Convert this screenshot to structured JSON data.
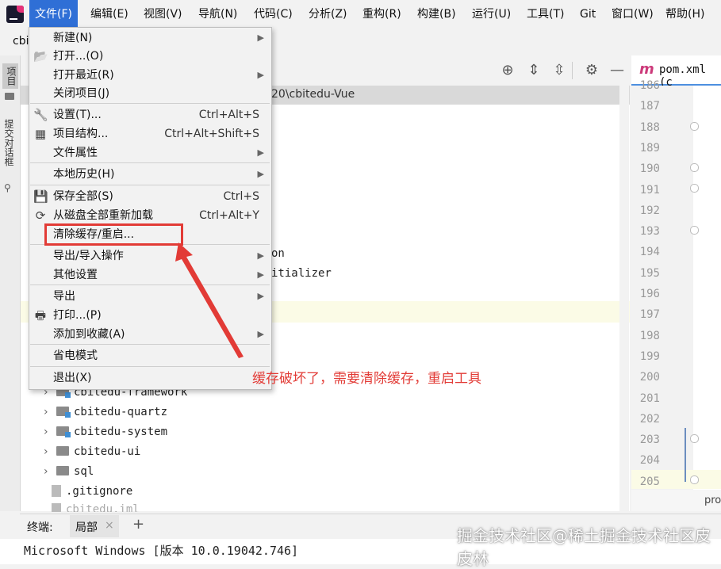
{
  "menubar": {
    "items": [
      "文件(F)",
      "编辑(E)",
      "视图(V)",
      "导航(N)",
      "代码(C)",
      "分析(Z)",
      "重构(R)",
      "构建(B)",
      "运行(U)",
      "工具(T)",
      "Git",
      "窗口(W)",
      "帮助(H)"
    ],
    "active_index": 0
  },
  "project_crumb": "cbi",
  "left_tabs": {
    "project": "项目",
    "commit": "提交对话框"
  },
  "tree": {
    "path_fragment": "20\\cbitedu-Vue",
    "partial_lines": [
      "on",
      "itializer"
    ],
    "rows": [
      {
        "label": "cbitedu-framework",
        "icon": "module-folder-icon"
      },
      {
        "label": "cbitedu-quartz",
        "icon": "module-folder-icon"
      },
      {
        "label": "cbitedu-system",
        "icon": "module-folder-icon"
      },
      {
        "label": "cbitedu-ui",
        "icon": "module-folder-icon"
      },
      {
        "label": "sql",
        "icon": "folder-icon"
      },
      {
        "label": ".gitignore",
        "icon": "file-icon"
      },
      {
        "label": "cbitedu.iml",
        "icon": "file-icon"
      }
    ]
  },
  "editor": {
    "tab_icon": "m",
    "tab_label": "pom.xml (c",
    "line_numbers": [
      "186",
      "187",
      "188",
      "189",
      "190",
      "191",
      "192",
      "193",
      "194",
      "195",
      "196",
      "197",
      "198",
      "199",
      "200",
      "201",
      "202",
      "203",
      "204",
      "205"
    ],
    "bottom_text": "pro"
  },
  "terminal": {
    "label": "终端:",
    "tab_label": "局部",
    "close": "×",
    "add": "+",
    "output": "Microsoft Windows [版本 10.0.19042.746]"
  },
  "file_menu": {
    "items": [
      {
        "label": "新建(N)",
        "shortcut": "",
        "submenu": true,
        "icon": ""
      },
      {
        "label": "打开...(O)",
        "shortcut": "",
        "submenu": false,
        "icon": "folder-open-icon"
      },
      {
        "label": "打开最近(R)",
        "shortcut": "",
        "submenu": true,
        "icon": ""
      },
      {
        "label": "关闭项目(J)",
        "shortcut": "",
        "submenu": false,
        "icon": ""
      },
      {
        "label": "设置(T)...",
        "shortcut": "Ctrl+Alt+S",
        "submenu": false,
        "icon": "wrench-icon"
      },
      {
        "label": "项目结构...",
        "shortcut": "Ctrl+Alt+Shift+S",
        "submenu": false,
        "icon": "project-structure-icon"
      },
      {
        "label": "文件属性",
        "shortcut": "",
        "submenu": true,
        "icon": ""
      },
      {
        "label": "本地历史(H)",
        "shortcut": "",
        "submenu": true,
        "icon": ""
      },
      {
        "label": "保存全部(S)",
        "shortcut": "Ctrl+S",
        "submenu": false,
        "icon": "save-icon"
      },
      {
        "label": "从磁盘全部重新加载",
        "shortcut": "Ctrl+Alt+Y",
        "submenu": false,
        "icon": "reload-icon"
      },
      {
        "label": "清除缓存/重启...",
        "shortcut": "",
        "submenu": false,
        "icon": ""
      },
      {
        "label": "导出/导入操作",
        "shortcut": "",
        "submenu": true,
        "icon": ""
      },
      {
        "label": "其他设置",
        "shortcut": "",
        "submenu": true,
        "icon": ""
      },
      {
        "label": "导出",
        "shortcut": "",
        "submenu": true,
        "icon": ""
      },
      {
        "label": "打印...(P)",
        "shortcut": "",
        "submenu": false,
        "icon": "print-icon"
      },
      {
        "label": "添加到收藏(A)",
        "shortcut": "",
        "submenu": true,
        "icon": ""
      },
      {
        "label": "省电模式",
        "shortcut": "",
        "submenu": false,
        "icon": ""
      },
      {
        "label": "退出(X)",
        "shortcut": "",
        "submenu": false,
        "icon": ""
      }
    ]
  },
  "annotation": {
    "text": "缓存破坏了，需要清除缓存，重启工具",
    "color": "#e23b36"
  },
  "watermark": "掘金技术社区@稀土掘金技术社区皮皮林",
  "colors": {
    "accent": "#2f6fd6",
    "annotation": "#e23b36",
    "maven": "#cc3a7a"
  }
}
